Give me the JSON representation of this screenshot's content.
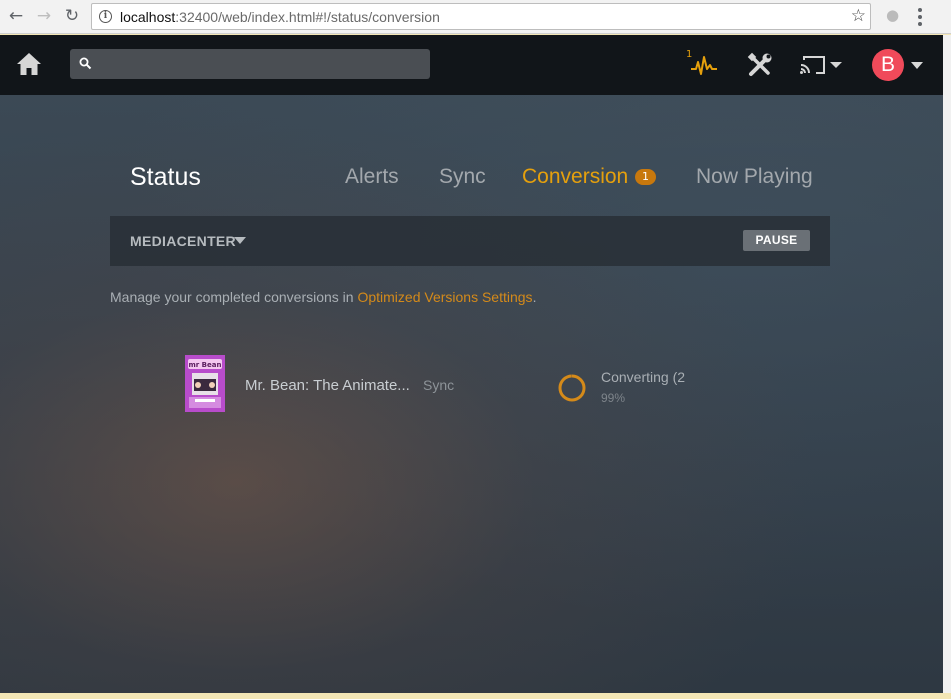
{
  "browser": {
    "url_host": "localhost",
    "url_rest": ":32400/web/index.html#!/status/conversion"
  },
  "topbar": {
    "activity_count": "1",
    "avatar_letter": "B",
    "accent_color": "#e5a00d"
  },
  "status": {
    "title": "Status",
    "tabs": [
      {
        "label": "Alerts",
        "active": false
      },
      {
        "label": "Sync",
        "active": false
      },
      {
        "label": "Conversion",
        "active": true,
        "badge": "1"
      },
      {
        "label": "Now Playing",
        "active": false
      }
    ],
    "server_name": "MEDIACENTER",
    "pause_label": "PAUSE",
    "manage_prefix": "Manage your completed conversions in ",
    "manage_link": "Optimized Versions Settings",
    "manage_suffix": "."
  },
  "conversions": [
    {
      "title": "Mr. Bean: The Animate...",
      "type": "Sync",
      "status": "Converting (2",
      "percent_text": "99%",
      "progress": 0.99
    }
  ]
}
